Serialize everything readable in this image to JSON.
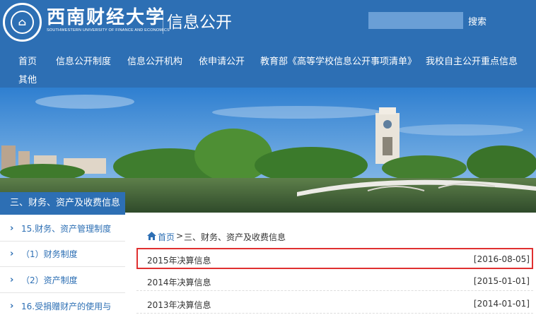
{
  "header": {
    "logo_cn": "西南财经大学",
    "logo_en": "SOUTHWESTERN UNIVERSITY OF FINANCE AND ECONOMICS",
    "site_title": "信息公开",
    "search": {
      "value": "",
      "button_label": "搜索"
    }
  },
  "nav": {
    "items": [
      "首页",
      "信息公开制度",
      "信息公开机构",
      "依申请公开",
      "教育部《高等学校信息公开事项清单》",
      "我校自主公开重点信息",
      "其他"
    ]
  },
  "sidebar": {
    "header": "三、财务、资产及收费信息",
    "items": [
      "15.财务、资产管理制度",
      "（1）财务制度",
      "（2）资产制度",
      "16.受捐赠财产的使用与"
    ]
  },
  "breadcrumb": {
    "home": "首页",
    "separator": ">",
    "current": "三、财务、资产及收费信息"
  },
  "articles": [
    {
      "title": "2015年决算信息",
      "date": "[2016-08-05]",
      "highlighted": true
    },
    {
      "title": "2014年决算信息",
      "date": "[2015-01-01]",
      "highlighted": false
    },
    {
      "title": "2013年决算信息",
      "date": "[2014-01-01]",
      "highlighted": false
    }
  ],
  "colors": {
    "brand_blue": "#2d6fb4",
    "search_field": "#6a9fd6",
    "highlight_red": "#e03030"
  },
  "icons": {
    "home": "home-icon",
    "chevron": "chevron-right-icon",
    "logo": "university-emblem-icon"
  }
}
